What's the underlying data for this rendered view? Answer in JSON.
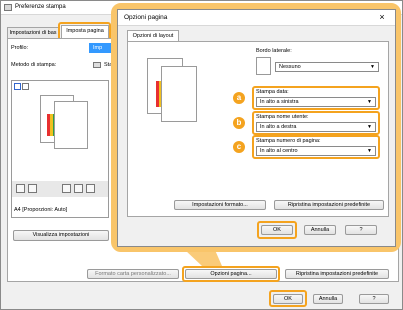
{
  "back_window": {
    "title": "Preferenze stampa",
    "tabs": [
      "Impostazioni di bas",
      "Imposta pagina"
    ],
    "profile_label": "Profilo:",
    "profile_value": "Imp",
    "method_label": "Metodo di stampa:",
    "method_value": "Stam",
    "paper_info": "A4 [Proporzioni: Auto]",
    "view_settings_label": "Visualizza impostazioni",
    "custom_paper_label": "Formato carta personalizzato...",
    "page_options_label": "Opzioni pagina...",
    "restore_label": "Ripristina impostazioni predefinite",
    "ok_label": "OK",
    "cancel_label": "Annulla",
    "help_label": "?"
  },
  "dialog": {
    "title": "Opzioni pagina",
    "tab": "Opzioni di layout",
    "border_label": "Bordo laterale:",
    "border_value": "Nessuno",
    "print_date_label": "Stampa data:",
    "print_date_value": "In alto a sinistra",
    "print_user_label": "Stampa nome utente:",
    "print_user_value": "In alto a destra",
    "print_page_label": "Stampa numero di pagina:",
    "print_page_value": "In alto al centro",
    "format_settings_label": "Impostazioni formato...",
    "restore_label": "Ripristina impostazioni predefinite",
    "ok_label": "OK",
    "cancel_label": "Annulla",
    "help_label": "?",
    "close_label": "×"
  },
  "badges": [
    "a",
    "b",
    "c"
  ],
  "colors": {
    "accent": "#f4a31f",
    "selection": "#3399ff"
  }
}
